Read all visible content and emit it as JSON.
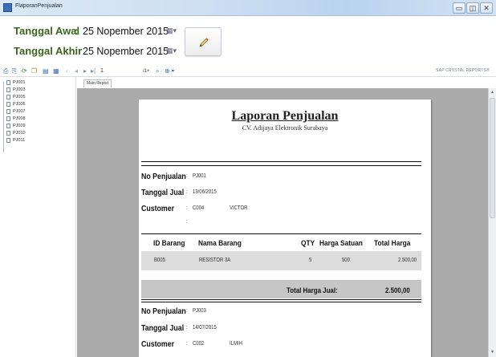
{
  "window": {
    "title": "FlaporanPenjualan",
    "buttons": {
      "minimize": "▭",
      "maximize": "◫",
      "close": "✕"
    }
  },
  "filter": {
    "start_label": "Tanggal Awal",
    "end_label": "Tanggal Akhir",
    "colon": ":",
    "start_date": "25 Nopember 2015",
    "end_date": "25 Nopember 2015",
    "picker_glyph": "▦▾"
  },
  "toolbar": {
    "page_value": "1",
    "page_of": "/1+",
    "brand": "SAP CRYSTAL REPORTS®"
  },
  "tree": {
    "items": [
      "PJ001",
      "PJ003",
      "PJ005",
      "PJ006",
      "PJ007",
      "PJ008",
      "PJ009",
      "PJ010",
      "PJ011"
    ]
  },
  "viewer": {
    "tab": "Main Report"
  },
  "report": {
    "title": "Laporan Penjualan",
    "subtitle": "CV. Adijaya Elektronik Surabaya",
    "labels": {
      "no_penjualan": "No Penjualan",
      "tanggal_jual": "Tanggal Jual",
      "customer": "Customer",
      "colon": ":"
    },
    "record1": {
      "no": "PJ001",
      "date": "13/06/2015",
      "customer_id": "C004",
      "customer_name": "VICTOR"
    },
    "columns": [
      "ID Barang",
      "Nama Barang",
      "QTY",
      "Harga Satuan",
      "Total Harga"
    ],
    "rows": [
      {
        "id": "B005",
        "name": "RESISTOR 3A",
        "qty": "5",
        "price": "500",
        "total": "2.500,00"
      }
    ],
    "total_label": "Total  Harga Jual:",
    "total_value": "2.500,00",
    "record2": {
      "no": "PJ003",
      "date": "14/07/2015",
      "customer_id": "C002",
      "customer_name": "ILMIH"
    }
  }
}
